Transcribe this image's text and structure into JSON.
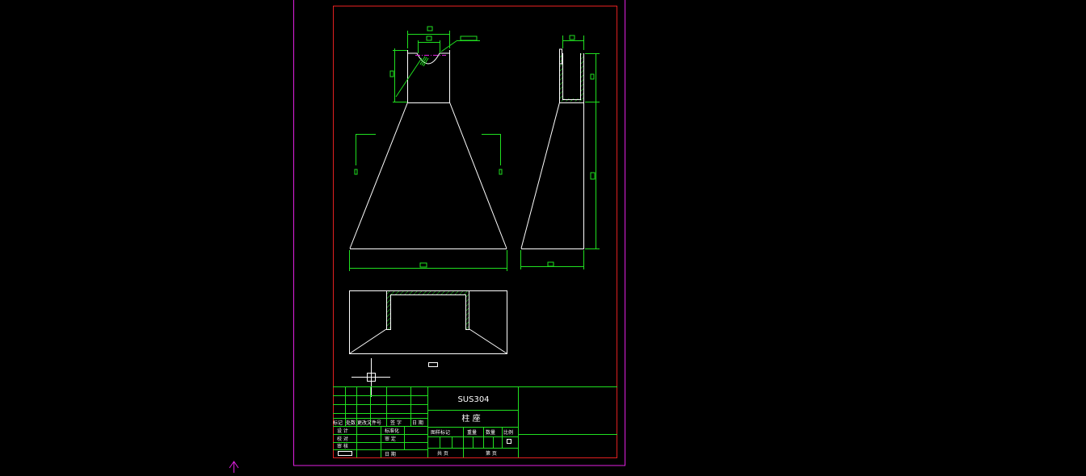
{
  "drawing": {
    "material": "SUS304",
    "part_name": "柱 座"
  },
  "title_block": {
    "rev_header": [
      "标记",
      "处数",
      "更改文件号",
      "签 字",
      "日 期"
    ],
    "left_rows": [
      {
        "label": "设 计",
        "label2": "标准化"
      },
      {
        "label": "校 对",
        "label2": "审 定"
      },
      {
        "label": "审 核",
        "label2": ""
      },
      {
        "label": "",
        "label2": "日 期"
      }
    ],
    "stage_mark": "图样标记",
    "weight": "重量",
    "qty": "数量",
    "scale": "比例",
    "total_sheets": "共  页",
    "sheet_no": "第  页"
  },
  "colors": {
    "layout_frame": "#e020e0",
    "border": "#e02020",
    "geometry": "#ffffff",
    "dimension": "#20e020",
    "hatch": "#20e020",
    "center": "#e020e0"
  }
}
